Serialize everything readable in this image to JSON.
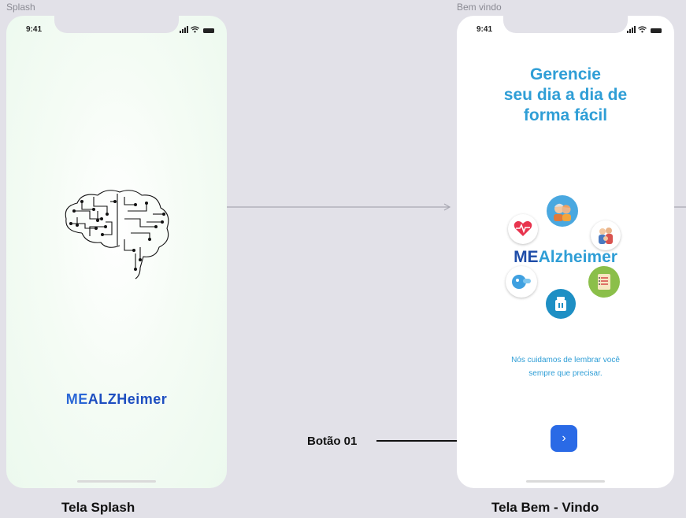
{
  "frames": [
    {
      "label": "Splash",
      "status_time": "9:41",
      "logo_me": "ME",
      "logo_text": "ALZHeimer",
      "caption": "Tela Splash"
    },
    {
      "label": "Bem vindo",
      "status_time": "9:41",
      "title_lines": [
        "Gerencie",
        "seu dia a dia de",
        "forma fácil"
      ],
      "logo_me": "ME",
      "logo_text": "Alzheimer",
      "subtitle_lines": [
        "Nós cuidamos de lembrar você",
        "sempre que precisar."
      ],
      "next_button_glyph": "›",
      "caption": "Tela  Bem - Vindo"
    }
  ],
  "annotation": {
    "label": "Botão 01"
  },
  "colors": {
    "canvas": "#e2e1e8",
    "accent_blue": "#2a6ae6",
    "title_blue": "#2f9ed6",
    "logo_dark_blue": "#1f4da8",
    "connector": "#a8a8b2"
  },
  "icons": [
    "brain-circuit-icon",
    "heart-pulse-icon",
    "elderly-couple-icon",
    "family-icon",
    "pills-icon",
    "checklist-icon",
    "medicine-bottle-icon",
    "chevron-right-icon",
    "signal-icon",
    "wifi-icon",
    "battery-icon"
  ]
}
